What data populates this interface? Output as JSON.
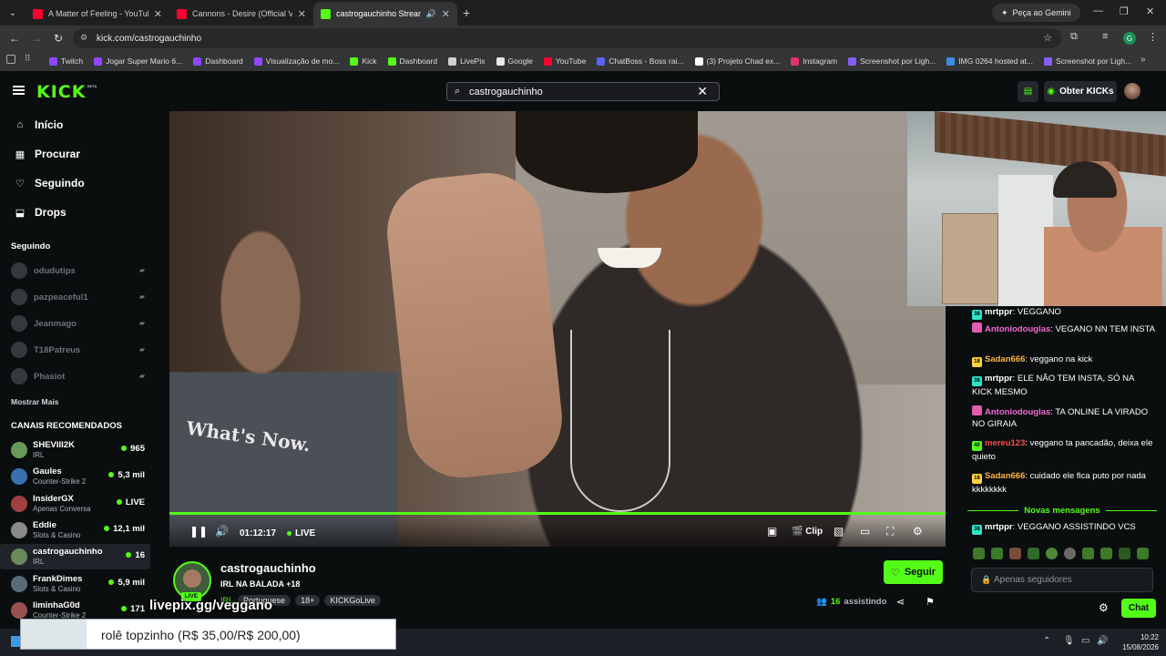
{
  "browser": {
    "tabs": [
      {
        "title": "A Matter of Feeling - YouTube",
        "color": "#ff0033",
        "active": false
      },
      {
        "title": "Cannons - Desire (Official Visu",
        "color": "#ff0033",
        "active": false
      },
      {
        "title": "castrogauchinho Stream - ",
        "color": "#53fc18",
        "active": true
      }
    ],
    "gemini_label": "Peça ao Gemini",
    "url": "kick.com/castrogauchinho",
    "profile_initial": "G",
    "bookmarks": [
      {
        "label": "Twitch",
        "color": "#9146ff"
      },
      {
        "label": "Jogar Super Mario 6...",
        "color": "#9146ff"
      },
      {
        "label": "Dashboard",
        "color": "#9146ff"
      },
      {
        "label": "Visualização de mo...",
        "color": "#9146ff"
      },
      {
        "label": "Kick",
        "color": "#53fc18"
      },
      {
        "label": "Dashboard",
        "color": "#53fc18"
      },
      {
        "label": "LivePix",
        "color": "#cfcfcf"
      },
      {
        "label": "Google",
        "color": "#e8e8e8"
      },
      {
        "label": "YouTube",
        "color": "#ff0033"
      },
      {
        "label": "ChatBoss - Boss rai...",
        "color": "#5865f2"
      },
      {
        "label": "(3) Projeto Chad ex...",
        "color": "#ffffff"
      },
      {
        "label": "Instagram",
        "color": "#e1306c"
      },
      {
        "label": "Screenshot por Ligh...",
        "color": "#8a5cf6"
      },
      {
        "label": "IMG 0264 hosted at...",
        "color": "#3a8ee6"
      },
      {
        "label": "Screenshot por Ligh...",
        "color": "#8a5cf6"
      }
    ]
  },
  "kick": {
    "logo": "KICK",
    "logo_badge": "BETA",
    "search_value": "castrogauchinho",
    "get_kicks_label": "Obter KICKs",
    "accent": "#53fc18"
  },
  "sidebar": {
    "nav": [
      {
        "label": "Início",
        "icon": "home-icon"
      },
      {
        "label": "Procurar",
        "icon": "browse-icon"
      },
      {
        "label": "Seguindo",
        "icon": "heart-icon"
      },
      {
        "label": "Drops",
        "icon": "drops-icon"
      }
    ],
    "following_title": "Seguindo",
    "following": [
      "odudutips",
      "pazpeaceful1",
      "Jeanmago",
      "T18Patreus",
      "Phasiot"
    ],
    "show_more": "Mostrar Mais",
    "recommended_title": "CANAIS RECOMENDADOS",
    "recommended": [
      {
        "name": "SHEVIII2K",
        "category": "IRL",
        "viewers": "965",
        "color": "#6a9a5a"
      },
      {
        "name": "Gaules",
        "category": "Counter-Strike 2",
        "viewers": "5,3 mil",
        "color": "#3b6fb0"
      },
      {
        "name": "InsiderGX",
        "category": "Apenas Conversa",
        "viewers": "LIVE",
        "color": "#a04040"
      },
      {
        "name": "Eddie",
        "category": "Slots & Casino",
        "viewers": "12,1 mil",
        "color": "#8a8a8a"
      },
      {
        "name": "castrogauchinho",
        "category": "IRL",
        "viewers": "16",
        "color": "#6b8a5b"
      },
      {
        "name": "FrankDimes",
        "category": "Slots & Casino",
        "viewers": "5,9 mil",
        "color": "#5a6a7a"
      },
      {
        "name": "liminhaG0d",
        "category": "Counter-Strike 2",
        "viewers": "171",
        "color": "#9a5050"
      }
    ]
  },
  "player": {
    "shirt_text": "What's Now.",
    "time": "01:12:17",
    "live_label": "LIVE",
    "clip_label": "Clip"
  },
  "chat": {
    "messages": [
      {
        "user": "mrtppr",
        "text": ": VEGGANO",
        "user_color": "#ffffff",
        "badge": "38",
        "badge_color": "#2ee6c8"
      },
      {
        "user": "Antoniodouglas",
        "text": ": VEGANO NN TEM INSTA",
        "user_color": "#f26bd3",
        "badge": "",
        "badge_color": "#e05db0"
      },
      {
        "user": "Sadan666",
        "text": ": veggano na kick",
        "user_color": "#ffb347",
        "badge": "18",
        "badge_color": "#ffd23f"
      },
      {
        "user": "mrtppr",
        "text": ": ELE NÃO TEM INSTA, SÓ NA KICK MESMO",
        "user_color": "#ffffff",
        "badge": "38",
        "badge_color": "#2ee6c8"
      },
      {
        "user": "Antoniodouglas",
        "text": ": TA ONLINE LA VIRADO NO GIRAIA",
        "user_color": "#f26bd3",
        "badge": "",
        "badge_color": "#e05db0"
      },
      {
        "user": "mereu123",
        "text": ": veggano ta pancadão, deixa ele quieto",
        "user_color": "#ff4d4d",
        "badge": "40",
        "badge_color": "#53fc18"
      },
      {
        "user": "Sadan666",
        "text": ": cuidado ele fica puto por nada kkkkkkkk",
        "user_color": "#ffb347",
        "badge": "18",
        "badge_color": "#ffd23f"
      },
      {
        "user": "mrtppr",
        "text": ": VEGGANO ASSISTINDO VCS",
        "user_color": "#ffffff",
        "badge": "38",
        "badge_color": "#2ee6c8"
      }
    ],
    "new_messages_label": "Novas mensagens",
    "input_placeholder": "Apenas seguidores",
    "send_label": "Chat"
  },
  "stream": {
    "streamer": "castrogauchinho",
    "title": "IRL NA BALADA +18",
    "live_badge": "LIVE",
    "category": "IRL",
    "tags": [
      "Portuguese",
      "18+",
      "KICKGoLive"
    ],
    "follow_label": "Seguir",
    "viewers": "16",
    "viewers_label": "assistindo"
  },
  "overlay": {
    "livepix": "livepix.gg/veggano",
    "donation_text": "rolê topzinho (R$ 35,00/R$ 200,00)"
  },
  "taskbar": {
    "time": "10:22",
    "date": "15/08/2026"
  }
}
